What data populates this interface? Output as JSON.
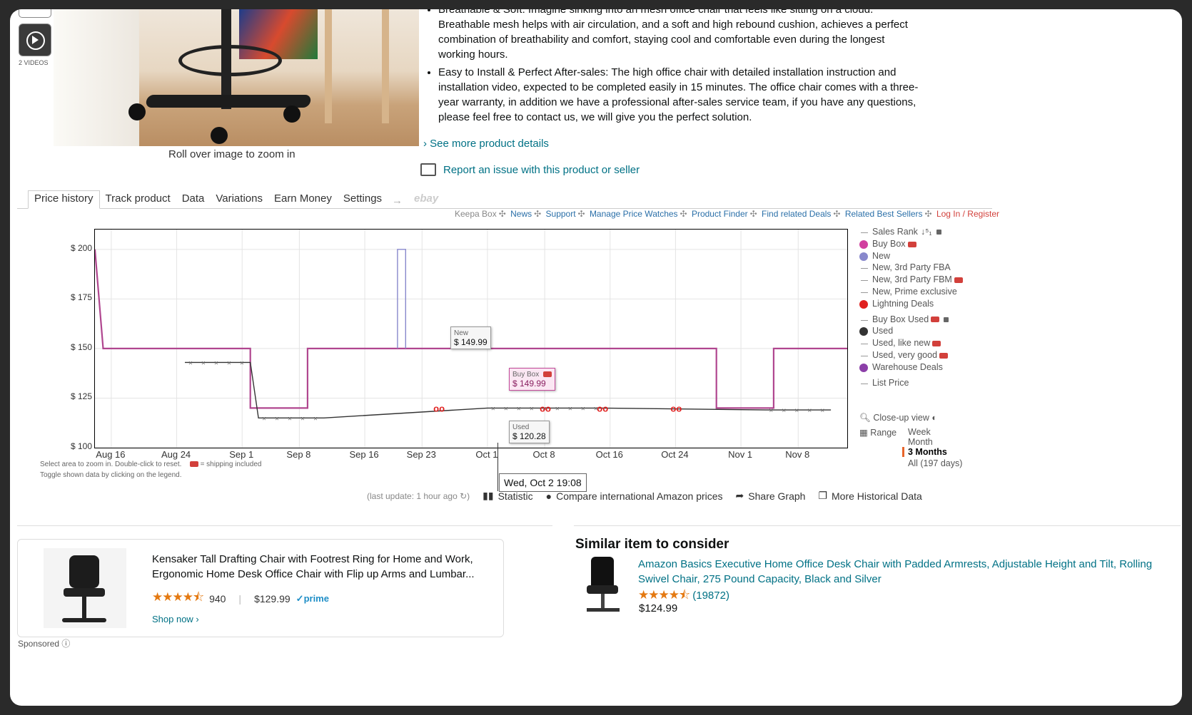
{
  "media": {
    "videos_label": "2 VIDEOS",
    "zoom_hint": "Roll over image to zoom in"
  },
  "bullets": [
    "Breathable & Soft: Imagine sinking into an mesh office chair that feels like sitting on a cloud. Breathable mesh helps with air circulation, and a soft and high rebound cushion, achieves a perfect combination of breathability and comfort, staying cool and comfortable even during the longest working hours.",
    "Easy to Install & Perfect After-sales: The high office chair with detailed installation instruction and installation video, expected to be completed easily in 15 minutes. The office chair comes with a three-year warranty, in addition we have a professional after-sales service team, if you have any questions, please feel free to contact us, we will give you the perfect solution."
  ],
  "see_more": "› See more product details",
  "report": "Report an issue with this product or seller",
  "keepa": {
    "tabs": [
      "Price history",
      "Track product",
      "Data",
      "Variations",
      "Earn Money",
      "Settings"
    ],
    "tab_arrow": "→",
    "ebay": "ebay",
    "links": [
      "Keepa Box",
      "News",
      "Support",
      "Manage Price Watches",
      "Product Finder",
      "Find related Deals",
      "Related Best Sellers",
      "Log In / Register"
    ],
    "hint1": "Select area to zoom in. Double-click to reset.",
    "hint_ship": "= shipping included",
    "hint2": "Toggle shown data by clicking on the legend.",
    "tooltip_new": {
      "label": "New",
      "value": "$ 149.99"
    },
    "tooltip_buybox": {
      "label": "Buy Box",
      "value": "$ 149.99"
    },
    "tooltip_used": {
      "label": "Used",
      "value": "$ 120.28"
    },
    "cursor_date": "Wed, Oct 2 19:08",
    "legend": [
      {
        "label": "Sales Rank",
        "kind": "line",
        "lock": true,
        "sort": "↓⁵₁"
      },
      {
        "label": "Buy Box",
        "kind": "dot",
        "color": "#d13f9f",
        "truck": true
      },
      {
        "label": "New",
        "kind": "dot",
        "color": "#8888cc"
      },
      {
        "label": "New, 3rd Party FBA",
        "kind": "line"
      },
      {
        "label": "New, 3rd Party FBM",
        "kind": "line",
        "truck": true
      },
      {
        "label": "New, Prime exclusive",
        "kind": "line"
      },
      {
        "label": "Lightning Deals",
        "kind": "dot",
        "color": "#e0201f"
      },
      {
        "label": "Buy Box Used",
        "kind": "line",
        "truck": true,
        "lock": true
      },
      {
        "label": "Used",
        "kind": "dot",
        "color": "#333333"
      },
      {
        "label": "Used, like new",
        "kind": "line",
        "truck": true
      },
      {
        "label": "Used, very good",
        "kind": "line",
        "truck": true
      },
      {
        "label": "Warehouse Deals",
        "kind": "dot",
        "color": "#8b3fa8"
      },
      {
        "label": "List Price",
        "kind": "line"
      }
    ],
    "closeup": "Close-up view",
    "range_label": "Range",
    "range_options": [
      "Week",
      "Month",
      "3 Months",
      "All (197 days)"
    ],
    "range_selected": "3 Months",
    "last_update": "(last update: 1 hour ago",
    "statistic": "Statistic",
    "compare": "Compare international Amazon prices",
    "share": "Share Graph",
    "more_hist": "More Historical Data"
  },
  "chart_data": {
    "type": "line",
    "x_ticks": [
      "Aug 16",
      "Aug 24",
      "Sep 1",
      "Sep 8",
      "Sep 16",
      "Sep 23",
      "Oct 1",
      "Oct 8",
      "Oct 16",
      "Oct 24",
      "Nov 1",
      "Nov 8"
    ],
    "y_ticks": [
      "$ 100",
      "$ 125",
      "$ 150",
      "$ 175",
      "$ 200"
    ],
    "ylim": [
      100,
      210
    ],
    "series": [
      {
        "name": "Buy Box",
        "color": "#b0468f",
        "points": [
          [
            "Aug 14",
            200
          ],
          [
            "Aug 15",
            150
          ],
          [
            "Sep 2",
            150
          ],
          [
            "Sep 2",
            120
          ],
          [
            "Sep 9",
            120
          ],
          [
            "Sep 9",
            150
          ],
          [
            "Oct 29",
            150
          ],
          [
            "Oct 29",
            120
          ],
          [
            "Nov 5",
            120
          ],
          [
            "Nov 5",
            150
          ],
          [
            "Nov 14",
            150
          ]
        ]
      },
      {
        "name": "New",
        "color": "#8888cc",
        "points": [
          [
            "Sep 20",
            150
          ],
          [
            "Sep 20",
            200
          ],
          [
            "Sep 21",
            200
          ],
          [
            "Sep 21",
            150
          ]
        ]
      },
      {
        "name": "Used",
        "color": "#333333",
        "points": [
          [
            "Aug 25",
            143
          ],
          [
            "Sep 2",
            143
          ],
          [
            "Sep 3",
            115
          ],
          [
            "Sep 11",
            115
          ],
          [
            "Oct 1",
            120
          ],
          [
            "Oct 15",
            120
          ],
          [
            "Nov 4",
            119
          ],
          [
            "Nov 12",
            119
          ]
        ]
      },
      {
        "name": "Lightning Deals",
        "color": "#e0201f",
        "points": [
          [
            "Sep 25",
            120
          ],
          [
            "Oct 8",
            120
          ],
          [
            "Oct 15",
            120
          ],
          [
            "Oct 24",
            120
          ]
        ]
      }
    ]
  },
  "ad": {
    "title": "Kensaker Tall Drafting Chair with Footrest Ring for Home and Work, Ergonomic Home Desk Office Chair with Flip up Arms and Lumbar...",
    "stars": "★★★★⯪",
    "reviews": "940",
    "sep": "|",
    "price": "$129.99",
    "prime": "✓prime",
    "shop_now": "Shop now ›",
    "sponsored": "Sponsored"
  },
  "similar": {
    "heading": "Similar item to consider",
    "title": "Amazon Basics Executive Home Office Desk Chair with Padded Armrests, Adjustable Height and Tilt, Rolling Swivel Chair, 275 Pound Capacity, Black and Silver",
    "stars": "★★★★⯪",
    "reviews": "(19872)",
    "price": "$124.99"
  }
}
